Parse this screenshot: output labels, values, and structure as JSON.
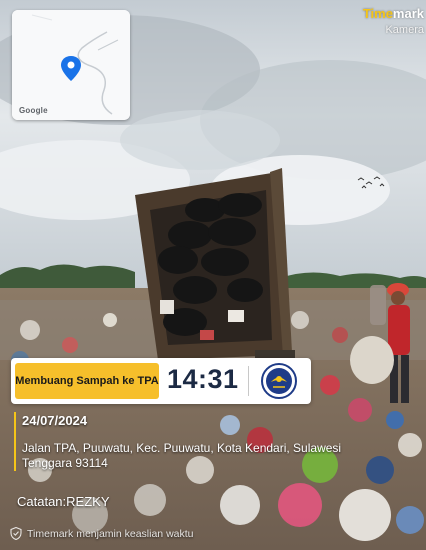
{
  "map": {
    "provider": "Google",
    "icons": [
      "location-pin-icon"
    ]
  },
  "watermark_brand": {
    "title_accent": "Time",
    "title_rest": "mark",
    "subtitle": "Kamera"
  },
  "stamp": {
    "activity": "Membuang Sampah ke TPA",
    "time": "14:31",
    "icons": [
      "government-emblem-icon"
    ]
  },
  "details": {
    "date": "24/07/2024",
    "address": "Jalan TPA, Puuwatu, Kec. Puuwatu, Kota Kendari, Sulawesi Tenggara 93114",
    "note": "Catatan:REZKY"
  },
  "footer": {
    "text": "Timemark menjamin keaslian waktu",
    "icons": [
      "shield-check-icon"
    ]
  },
  "colors": {
    "accent_yellow": "#f6bf2b",
    "time_navy": "#1c2a44",
    "truck_dark": "#4a3a2c"
  }
}
